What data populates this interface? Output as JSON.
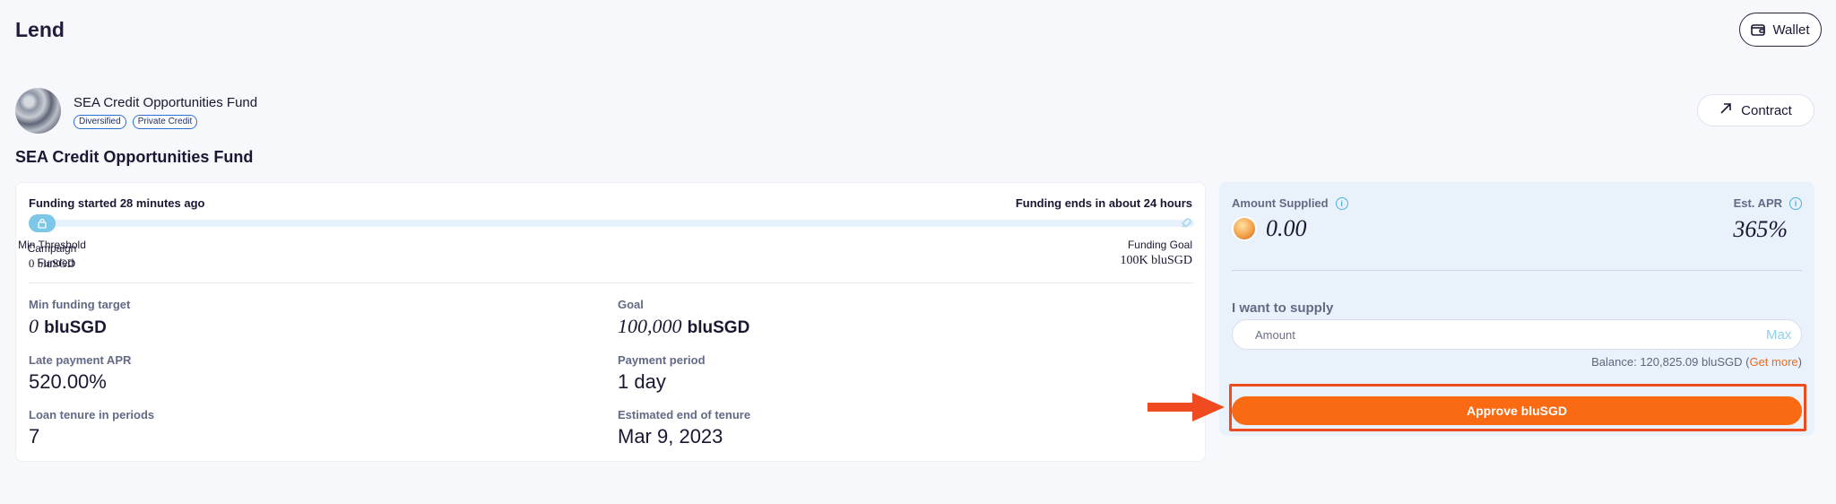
{
  "header": {
    "title": "Lend",
    "wallet_label": "Wallet"
  },
  "fund": {
    "name": "SEA Credit Opportunities Fund",
    "tags": [
      "Diversified",
      "Private Credit"
    ],
    "contract_label": "Contract",
    "title": "SEA Credit Opportunities Fund"
  },
  "campaign": {
    "funding_started": "Funding started 28 minutes ago",
    "funding_ends": "Funding ends in about 24 hours",
    "progress_fraction": 0.0,
    "min_threshold_label": "Min Threshold",
    "campaign_label": "Campaign",
    "min_threshold_amount": "0 bluSGD",
    "funded_label": "Funded",
    "funding_goal_label": "Funding Goal",
    "funding_goal_amount": "100K bluSGD"
  },
  "stats": {
    "min_funding_target": {
      "label": "Min funding target",
      "value": "0",
      "unit": "bluSGD"
    },
    "goal": {
      "label": "Goal",
      "value": "100,000",
      "unit": "bluSGD"
    },
    "late_payment_apr": {
      "label": "Late payment APR",
      "value": "520.00%"
    },
    "payment_period": {
      "label": "Payment period",
      "value": "1 day"
    },
    "loan_tenure": {
      "label": "Loan tenure in periods",
      "value": "7"
    },
    "estimated_end": {
      "label": "Estimated end of tenure",
      "value": "Mar 9, 2023"
    }
  },
  "supply": {
    "amount_supplied_label": "Amount Supplied",
    "amount_supplied_value": "0.00",
    "est_apr_label": "Est. APR",
    "est_apr_value": "365%",
    "want_to_supply_label": "I want to supply",
    "amount_placeholder": "Amount",
    "max_label": "Max",
    "balance_text": "Balance: 120,825.09 bluSGD (",
    "get_more_label": "Get more",
    "balance_close": ")",
    "approve_label": "Approve bluSGD"
  },
  "colors": {
    "accent": "#f96a13",
    "highlight": "#f04b20",
    "progress": "#9ed3ee"
  }
}
